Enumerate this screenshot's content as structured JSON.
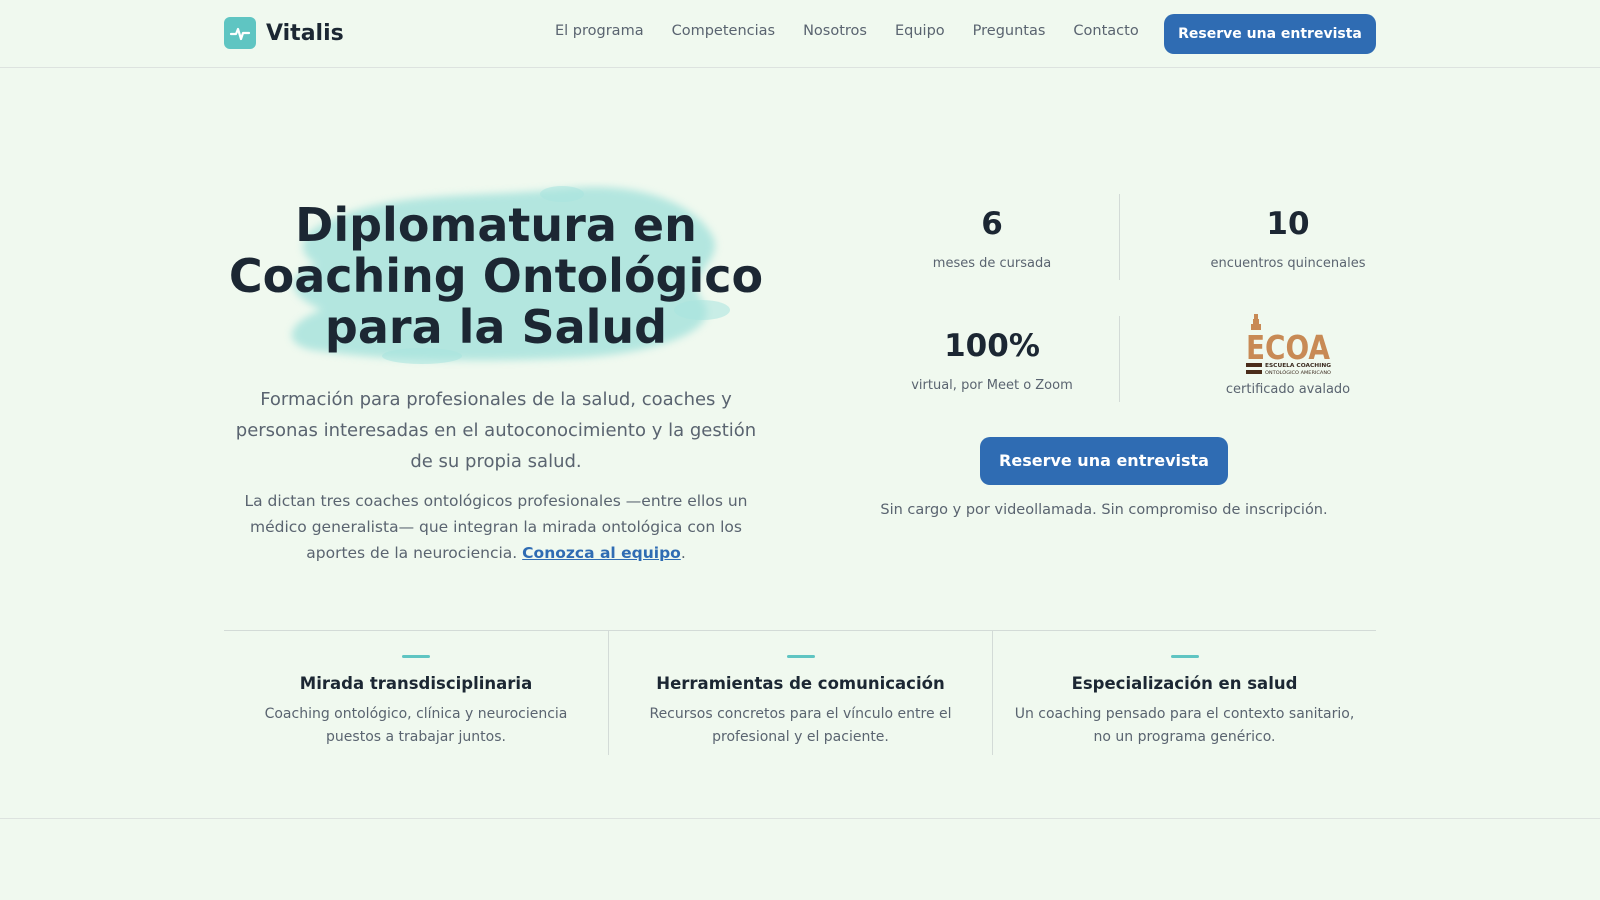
{
  "header": {
    "brand": "Vitalis",
    "nav": [
      "El programa",
      "Competencias",
      "Nosotros",
      "Equipo",
      "Preguntas",
      "Contacto"
    ],
    "cta": "Reserve una entrevista"
  },
  "hero": {
    "title": "Diplomatura en Coaching Ontológico para la Salud",
    "subtitle": "Formación para profesionales de la salud, coaches y personas interesadas en el autoconocimiento y la gestión de su propia salud.",
    "description": "La dictan tres coaches ontológicos profesionales —entre ellos un médico generalista— que integran la mirada ontológica con los aportes de la neurociencia.",
    "link_text": "Conozca al equipo",
    "link_suffix": ".",
    "accent_color": "#5fc5c2"
  },
  "stats": {
    "items": [
      {
        "value": "6",
        "label": "meses de cursada"
      },
      {
        "value": "10",
        "label": "encuentros quincenales"
      },
      {
        "value": "100%",
        "label": "virtual, por Meet o Zoom"
      }
    ],
    "certificate": {
      "logo_text": "ECOA",
      "logo_sub_1": "ESCUELA COACHING",
      "logo_sub_2": "ONTOLÓGICO AMERICANO",
      "label": "certificado avalado",
      "logo_color": "#c88a55"
    },
    "cta": "Reserve una entrevista",
    "note": "Sin cargo y por videollamada. Sin compromiso de inscripción."
  },
  "features": [
    {
      "title": "Mirada transdisciplinaria",
      "text": "Coaching ontológico, clínica y neurociencia puestos a trabajar juntos."
    },
    {
      "title": "Herramientas de comunicación",
      "text": "Recursos concretos para el vínculo entre el profesional y el paciente."
    },
    {
      "title": "Especialización en salud",
      "text": "Un coaching pensado para el contexto sanitario, no un programa genérico."
    }
  ],
  "colors": {
    "background": "#f0f9ef",
    "primary": "#2f6cb3",
    "text": "#1c2733",
    "muted": "#5a6470"
  }
}
